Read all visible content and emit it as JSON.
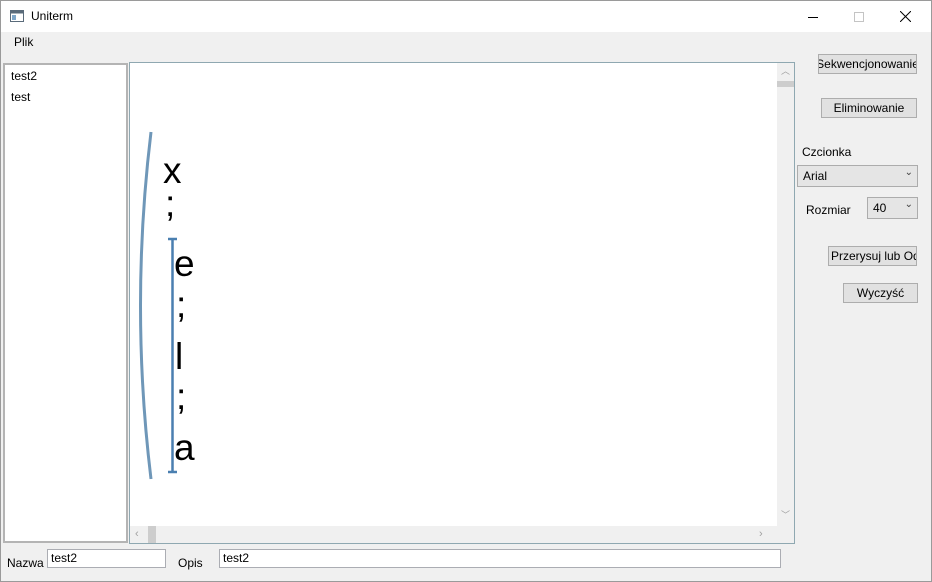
{
  "window": {
    "title": "Uniterm",
    "controls": [
      "minimize",
      "maximize",
      "close"
    ]
  },
  "menu": {
    "items": [
      "Plik"
    ]
  },
  "list": {
    "items": [
      "test2",
      "test"
    ]
  },
  "canvas": {
    "outer_term": [
      "x",
      ";"
    ],
    "inner_term": [
      "e",
      ";",
      "l",
      ";",
      "a"
    ],
    "bracket_color": "#6f97b8",
    "bar_color": "#4a7fb0"
  },
  "side": {
    "sequence_button": "Sekwencjonowanie",
    "eliminate_button": "Eliminowanie",
    "font_label": "Czcionka",
    "font_value": "Arial",
    "size_label": "Rozmiar",
    "size_value": "40",
    "redraw_button": "Przerysuj lub Odśwież",
    "clear_button": "Wyczyść"
  },
  "footer": {
    "name_label": "Nazwa",
    "name_value": "test2",
    "desc_label": "Opis",
    "desc_value": "test2"
  }
}
